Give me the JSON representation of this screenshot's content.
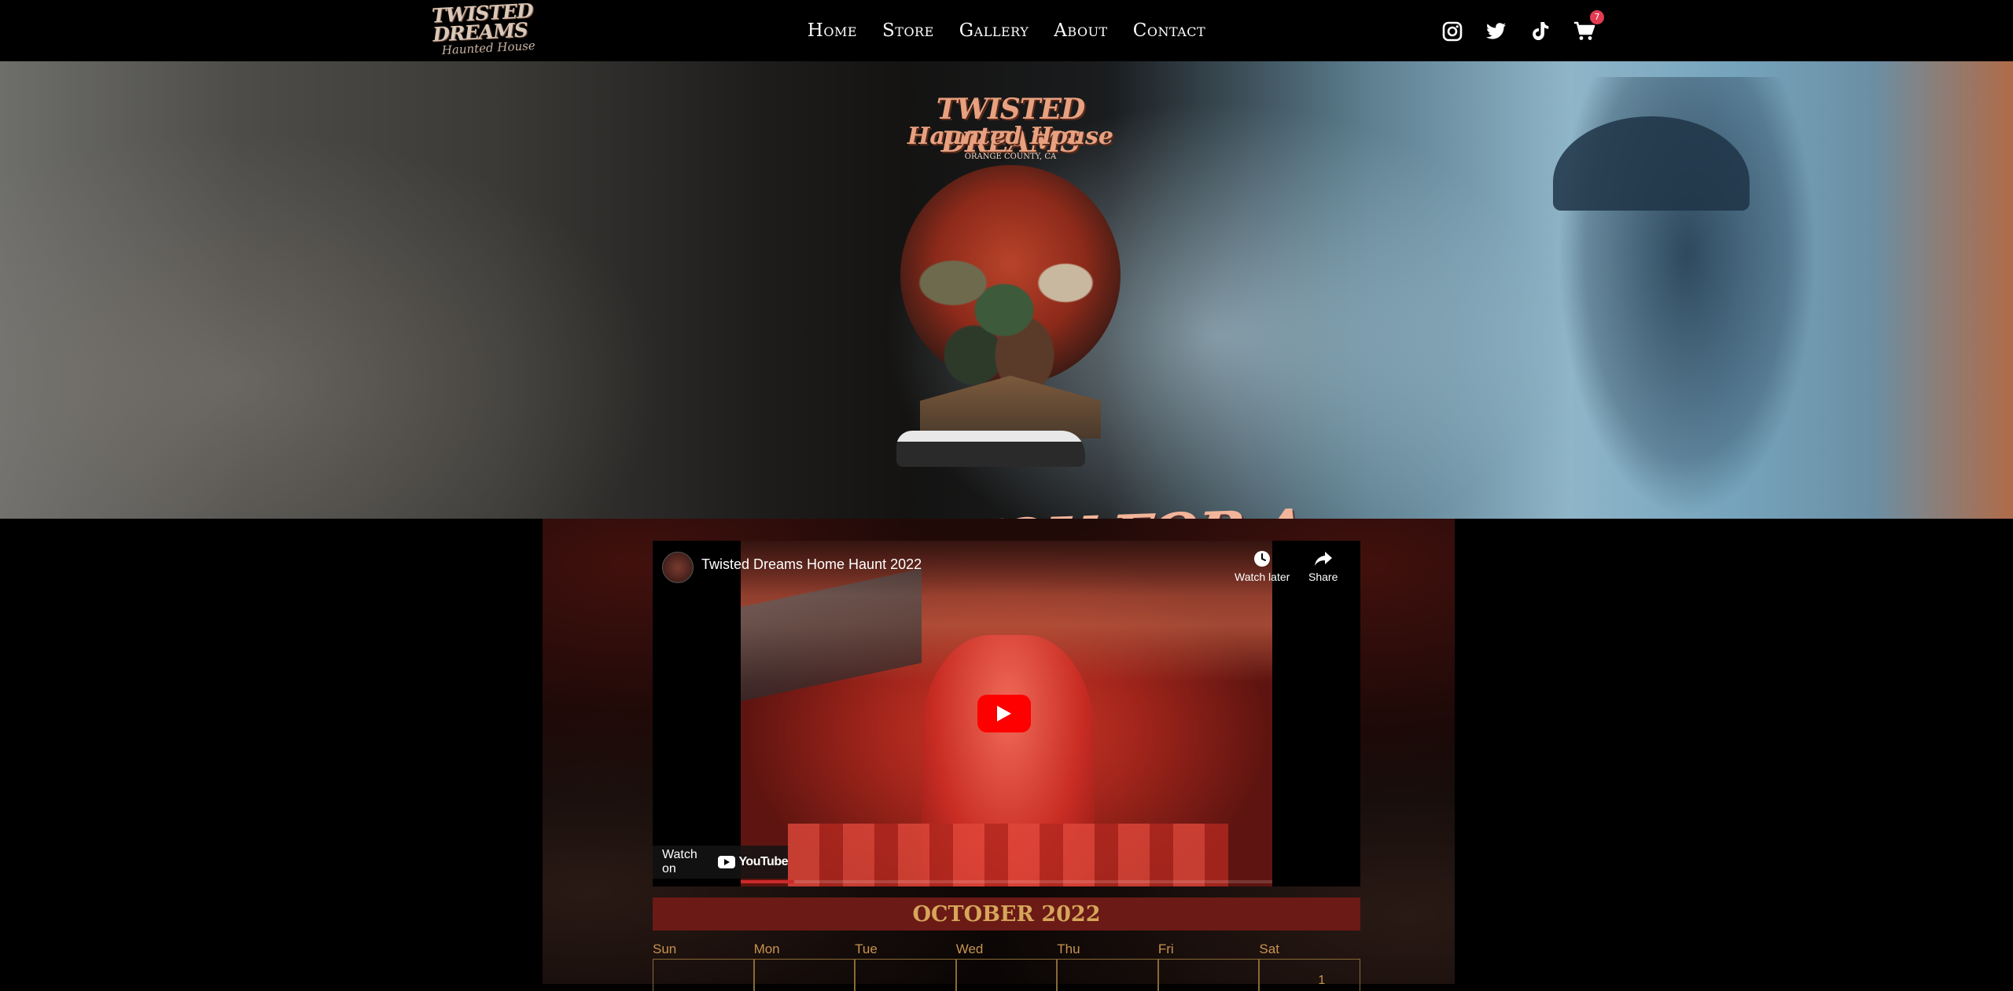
{
  "brand": {
    "logo_line1": "TWISTED DREAMS",
    "logo_line2": "Haunted House"
  },
  "nav": {
    "links": [
      "Home",
      "Store",
      "Gallery",
      "About",
      "Contact"
    ]
  },
  "social": {
    "icons": [
      "instagram-icon",
      "twitter-icon",
      "tiktok-icon",
      "cart-icon"
    ],
    "cart_count": "7"
  },
  "hero": {
    "poster_title1": "TWISTED DREAMS",
    "poster_title2": "Haunted House",
    "poster_subtitle": "ORANGE COUNTY, CA",
    "thanks_text": "THANK YOU FOR A GREAT HAUNT!"
  },
  "video": {
    "title": "Twisted Dreams Home Haunt 2022",
    "watch_later": "Watch later",
    "share": "Share",
    "watch_on": "Watch on",
    "platform": "YouTube",
    "progress": 0.1
  },
  "calendar": {
    "month": "OCTOBER 2022",
    "days": [
      "Sun",
      "Mon",
      "Tue",
      "Wed",
      "Thu",
      "Fri",
      "Sat"
    ],
    "first_row": [
      "",
      "",
      "",
      "",
      "",
      "",
      "1"
    ]
  },
  "colors": {
    "accent_red": "#6b1a16",
    "calendar_gold": "#c8934f",
    "cart_badge": "#e23b52",
    "youtube_red": "#ff0000"
  }
}
